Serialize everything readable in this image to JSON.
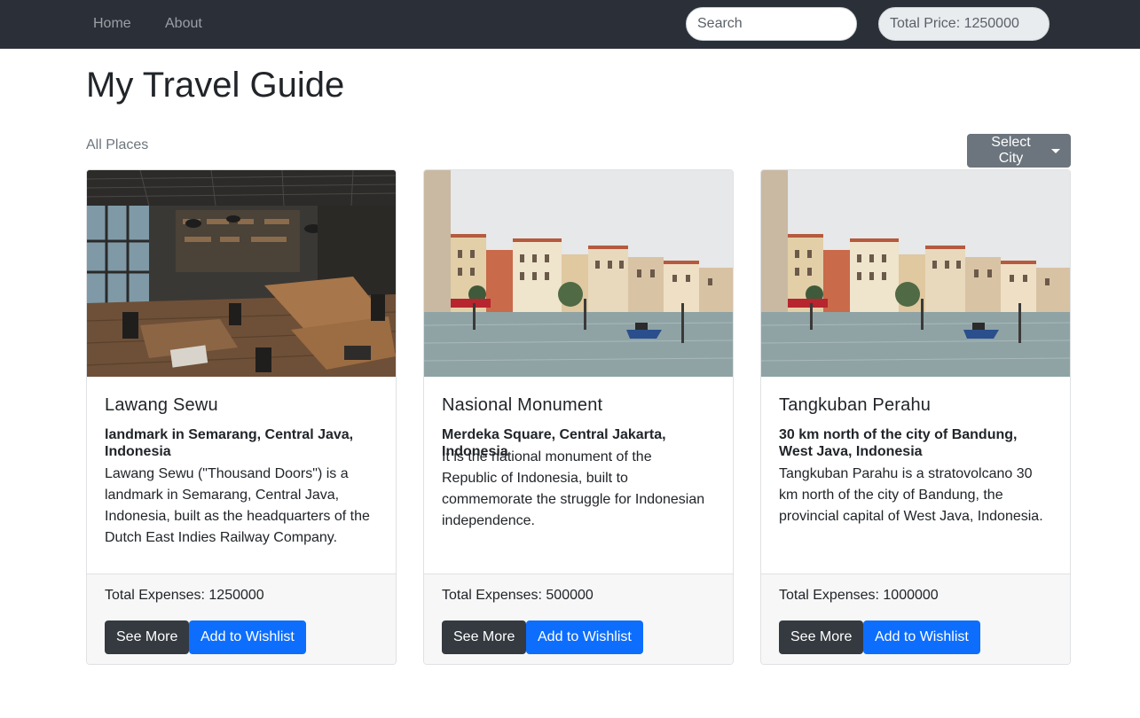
{
  "nav": {
    "links": [
      "Home",
      "About"
    ],
    "search_placeholder": "Search",
    "total_price": "Total Price: 1250000"
  },
  "page": {
    "title": "My Travel Guide",
    "section_label": "All Places",
    "select_city_label": "Select City"
  },
  "cards": [
    {
      "title": "Lawang Sewu",
      "subtitle": "landmark in Semarang, Central Java, Indonesia",
      "text": "Lawang Sewu (\"Thousand Doors\") is a landmark in Semarang, Central Java, Indonesia, built as the headquarters of the Dutch East Indies Railway Company.",
      "expenses": "Total Expenses: 1250000",
      "see_more_label": "See More",
      "wishlist_label": "Add to Wishlist",
      "image": "cafe-interior"
    },
    {
      "title": "Nasional Monument",
      "subtitle": "Merdeka Square, Central Jakarta, Indonesia",
      "text": "It is the national monument of the Republic of Indonesia, built to commemorate the struggle for Indonesian independence.",
      "expenses": "Total Expenses: 500000",
      "see_more_label": "See More",
      "wishlist_label": "Add to Wishlist",
      "image": "canal-city"
    },
    {
      "title": "Tangkuban Perahu",
      "subtitle": "30 km north of the city of Bandung, West Java, Indonesia",
      "text": "Tangkuban Parahu is a stratovolcano 30 km north of the city of Bandung, the provincial capital of West Java, Indonesia.",
      "expenses": "Total Expenses: 1000000",
      "see_more_label": "See More",
      "wishlist_label": "Add to Wishlist",
      "image": "canal-city"
    }
  ],
  "colors": {
    "navbar": "#2b3038",
    "primary": "#0d6efd",
    "dark": "#343a40",
    "secondary": "#6c757d"
  }
}
